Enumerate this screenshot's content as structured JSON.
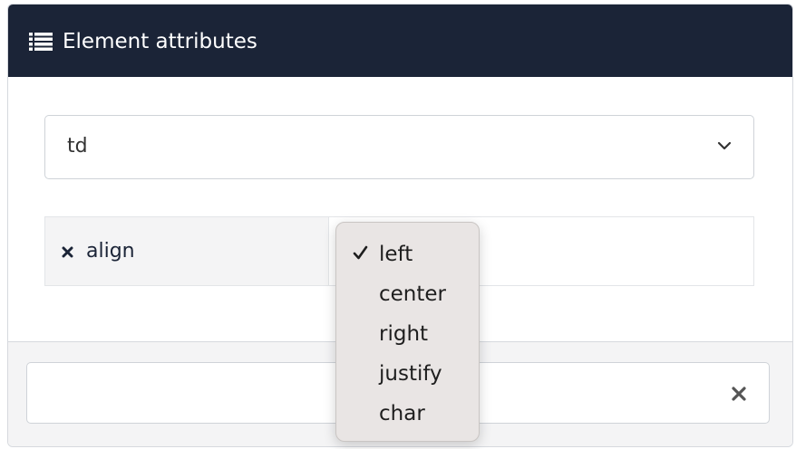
{
  "header": {
    "title": "Element attributes",
    "icon": "list-icon"
  },
  "element_select": {
    "selected": "td",
    "icon": "chevron-down-icon"
  },
  "attribute": {
    "name": "align",
    "remove_icon": "close-icon"
  },
  "dropdown": {
    "selected_index": 0,
    "options": [
      "left",
      "center",
      "right",
      "justify",
      "char"
    ]
  },
  "footer": {
    "input_value": "",
    "clear_icon": "close-icon"
  },
  "colors": {
    "header_bg": "#1b2437",
    "header_text": "#ffffff",
    "dropdown_bg": "#e9e5e4",
    "attr_name_bg": "#f4f4f5"
  }
}
